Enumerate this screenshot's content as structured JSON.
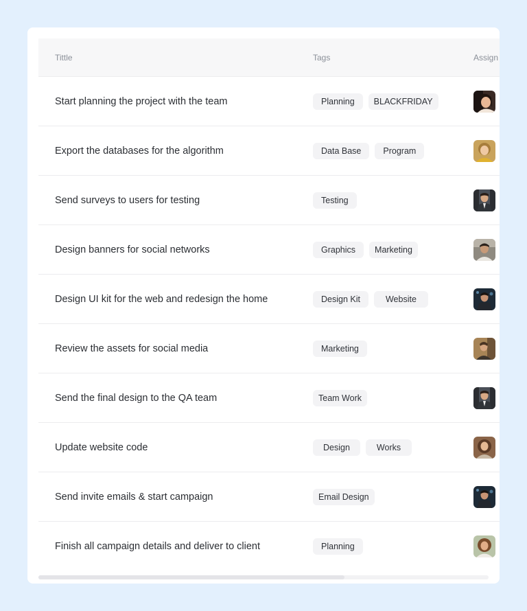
{
  "table": {
    "headers": {
      "title": "Tittle",
      "tags": "Tags",
      "assign": "Assign"
    },
    "rows": [
      {
        "title": "Start planning the project with the team",
        "tags": [
          "Planning",
          "BLACKFRIDAY"
        ],
        "avatar": "avatar-1"
      },
      {
        "title": "Export the databases for the algorithm",
        "tags": [
          "Data Base",
          "Program"
        ],
        "avatar": "avatar-2"
      },
      {
        "title": "Send surveys to users for testing",
        "tags": [
          "Testing"
        ],
        "avatar": "avatar-3"
      },
      {
        "title": "Design banners for social networks",
        "tags": [
          "Graphics",
          "Marketing"
        ],
        "avatar": "avatar-4"
      },
      {
        "title": "Design UI kit for the web and redesign the home",
        "tags": [
          "Design Kit",
          "Website"
        ],
        "avatar": "avatar-5"
      },
      {
        "title": "Review the assets for social media",
        "tags": [
          "Marketing"
        ],
        "avatar": "avatar-6"
      },
      {
        "title": "Send the final design to the QA team",
        "tags": [
          "Team Work"
        ],
        "avatar": "avatar-3"
      },
      {
        "title": "Update website code",
        "tags": [
          "Design",
          "Works"
        ],
        "avatar": "avatar-7"
      },
      {
        "title": "Send invite emails & start campaign",
        "tags": [
          "Email Design"
        ],
        "avatar": "avatar-5"
      },
      {
        "title": "Finish all campaign details and deliver to client",
        "tags": [
          "Planning"
        ],
        "avatar": "avatar-8"
      }
    ]
  },
  "colors": {
    "page_bg": "#e3f0fd",
    "card_bg": "#ffffff",
    "header_bg": "#f7f7f8",
    "tag_bg": "#f3f3f5",
    "text": "#2b2e33",
    "muted": "#8a8f98"
  }
}
